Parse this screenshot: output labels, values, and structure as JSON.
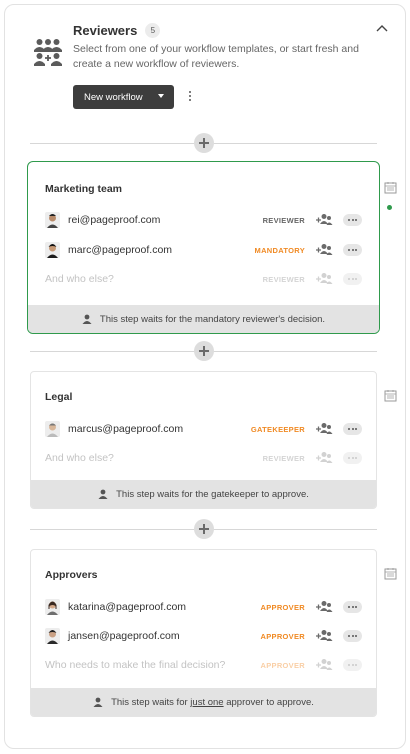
{
  "header": {
    "title": "Reviewers",
    "count": "5",
    "description": "Select from one of your workflow templates, or start fresh and create a new workflow of reviewers.",
    "new_workflow_label": "New workflow"
  },
  "steps": [
    {
      "name": "Marketing team",
      "selected": true,
      "reviewers": [
        {
          "email": "rei@pageproof.com",
          "role": "REVIEWER"
        },
        {
          "email": "marc@pageproof.com",
          "role": "MANDATORY"
        }
      ],
      "add_placeholder": "And who else?",
      "add_role": "REVIEWER",
      "footer_text": "This step waits for the mandatory reviewer's decision."
    },
    {
      "name": "Legal",
      "selected": false,
      "reviewers": [
        {
          "email": "marcus@pageproof.com",
          "role": "GATEKEEPER"
        }
      ],
      "add_placeholder": "And who else?",
      "add_role": "REVIEWER",
      "footer_text": "This step waits for the gatekeeper to approve."
    },
    {
      "name": "Approvers",
      "selected": false,
      "reviewers": [
        {
          "email": "katarina@pageproof.com",
          "role": "APPROVER"
        },
        {
          "email": "jansen@pageproof.com",
          "role": "APPROVER"
        }
      ],
      "add_placeholder": "Who needs to make the final decision?",
      "add_role": "APPROVER",
      "footer_prefix": "This step waits for",
      "footer_emphasis": "just one",
      "footer_suffix": "approver to approve."
    }
  ],
  "icons": {
    "header": "reviewers-group-icon",
    "collapse": "chevron-up-icon",
    "add_user": "add-user-icon",
    "side": "calendar-icon"
  },
  "colors": {
    "selected_border": "#2f9a4c",
    "role_accent": "#f08a24",
    "button_dark": "#3d3d3d"
  }
}
